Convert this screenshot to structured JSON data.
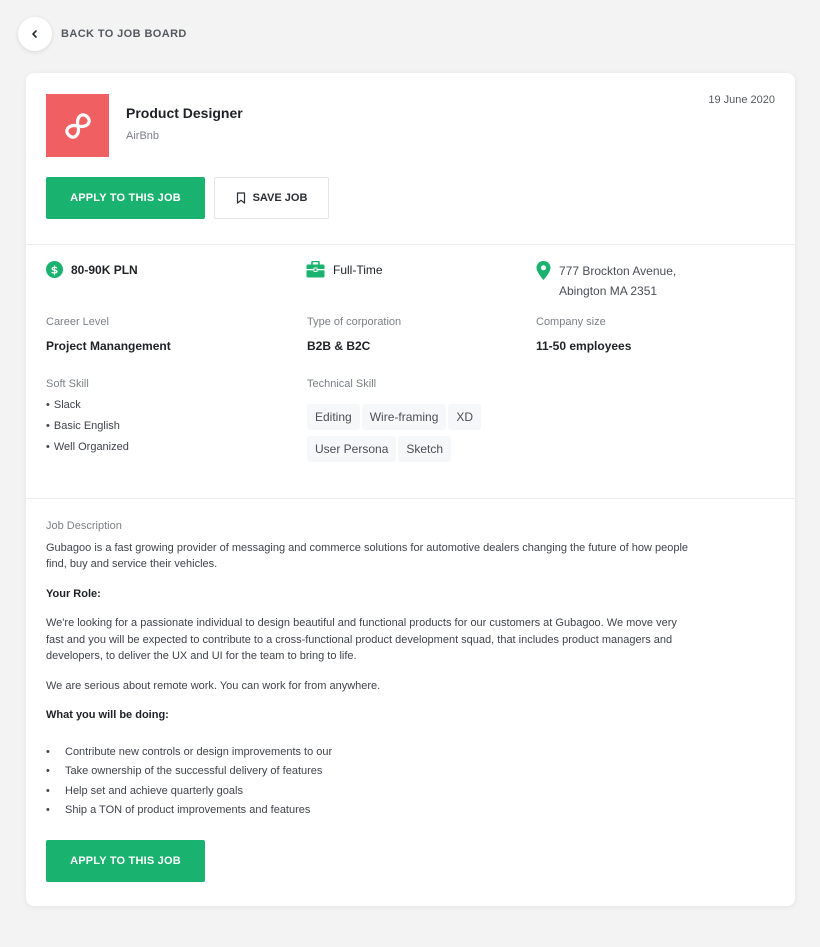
{
  "nav": {
    "back_label": "BACK TO JOB BOARD"
  },
  "job": {
    "title": "Product Designer",
    "company": "AirBnb",
    "date": "19 June 2020",
    "apply_label": "APPLY TO THIS JOB",
    "save_label": "SAVE JOB",
    "salary": "80-90K PLN",
    "employment_type": "Full-Time",
    "address_line1": "777 Brockton Avenue,",
    "address_line2": "Abington MA 2351"
  },
  "details": {
    "career_level_label": "Career Level",
    "career_level": "Project Manangement",
    "corp_type_label": "Type of corporation",
    "corp_type": "B2B & B2C",
    "company_size_label": "Company size",
    "company_size": "11-50 employees",
    "soft_skill_label": "Soft Skill",
    "soft_skills": [
      "Slack",
      "Basic English",
      "Well Organized"
    ],
    "tech_skill_label": "Technical Skill",
    "tech_skills": [
      "Editing",
      "Wire-framing",
      "XD",
      "User Persona",
      "Sketch"
    ]
  },
  "description": {
    "label": "Job Description",
    "intro": "Gubagoo is a fast growing provider of messaging and commerce solutions for automotive dealers changing the future of how people find, buy and service their vehicles.",
    "role_heading": "Your Role:",
    "role_text": "We're looking for a passionate individual to design beautiful and functional products for our customers at Gubagoo. We move very fast and you will be expected to contribute to a cross-functional product development squad, that includes product managers and developers, to deliver the UX and UI for the team to bring to life.",
    "remote_text": "We are serious about remote work. You can work for from anywhere.",
    "doing_heading": "What you will be doing:",
    "doing_items": [
      "Contribute new controls or design improvements to our",
      "Take ownership of the successful delivery of features",
      "Help set and achieve quarterly goals",
      "Ship a TON of product improvements and features"
    ]
  },
  "colors": {
    "accent": "#1ab26f",
    "logo_bg": "#f05f62"
  }
}
